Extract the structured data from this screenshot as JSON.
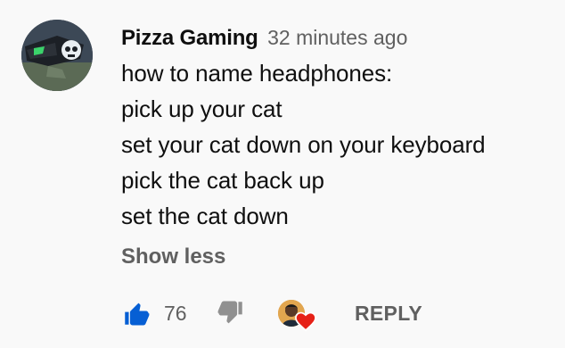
{
  "comment": {
    "author": "Pizza Gaming",
    "timestamp": "32 minutes ago",
    "lines": [
      "how to name headphones:",
      "pick up your cat",
      "set your cat down on your keyboard",
      "pick the cat back up",
      "set the cat down"
    ],
    "show_less_label": "Show less",
    "like_count": "76",
    "reply_label": "REPLY",
    "like_active": true
  },
  "icons": {
    "like": "thumbs-up-icon",
    "dislike": "thumbs-down-icon",
    "heart": "heart-icon"
  },
  "colors": {
    "background": "#f9f9f9",
    "like_active": "#065fd4",
    "muted": "#606060",
    "heart": "#e62117"
  }
}
